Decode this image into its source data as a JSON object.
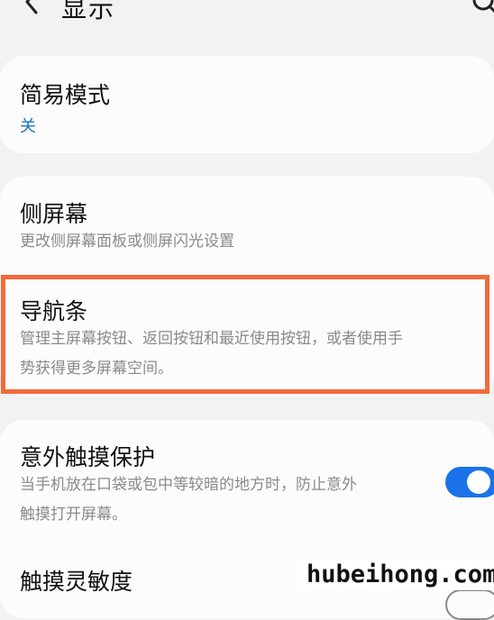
{
  "header": {
    "title": "显示",
    "back_icon": "chevron-left-icon",
    "search_icon": "search-icon"
  },
  "easy_mode": {
    "title": "简易模式",
    "value": "关"
  },
  "edge_screen": {
    "title": "侧屏幕",
    "subtitle": "更改侧屏幕面板或侧屏闪光设置"
  },
  "navigation_bar": {
    "title": "导航条",
    "subtitle_line1": "管理主屏幕按钮、返回按钮和最近使用按钮，或者使用手",
    "subtitle_line2": "势获得更多屏幕空间。"
  },
  "accidental_touch": {
    "title": "意外触摸保护",
    "subtitle_line1": "当手机放在口袋或包中等较暗的地方时，防止意外",
    "subtitle_line2": "触摸打开屏幕。",
    "toggle_on": true
  },
  "touch_sensitivity": {
    "title": "触摸灵敏度",
    "toggle_on": false
  },
  "watermark": "hubeihong.com",
  "colors": {
    "accent": "#1a73e8",
    "highlight": "#f26a3a"
  }
}
